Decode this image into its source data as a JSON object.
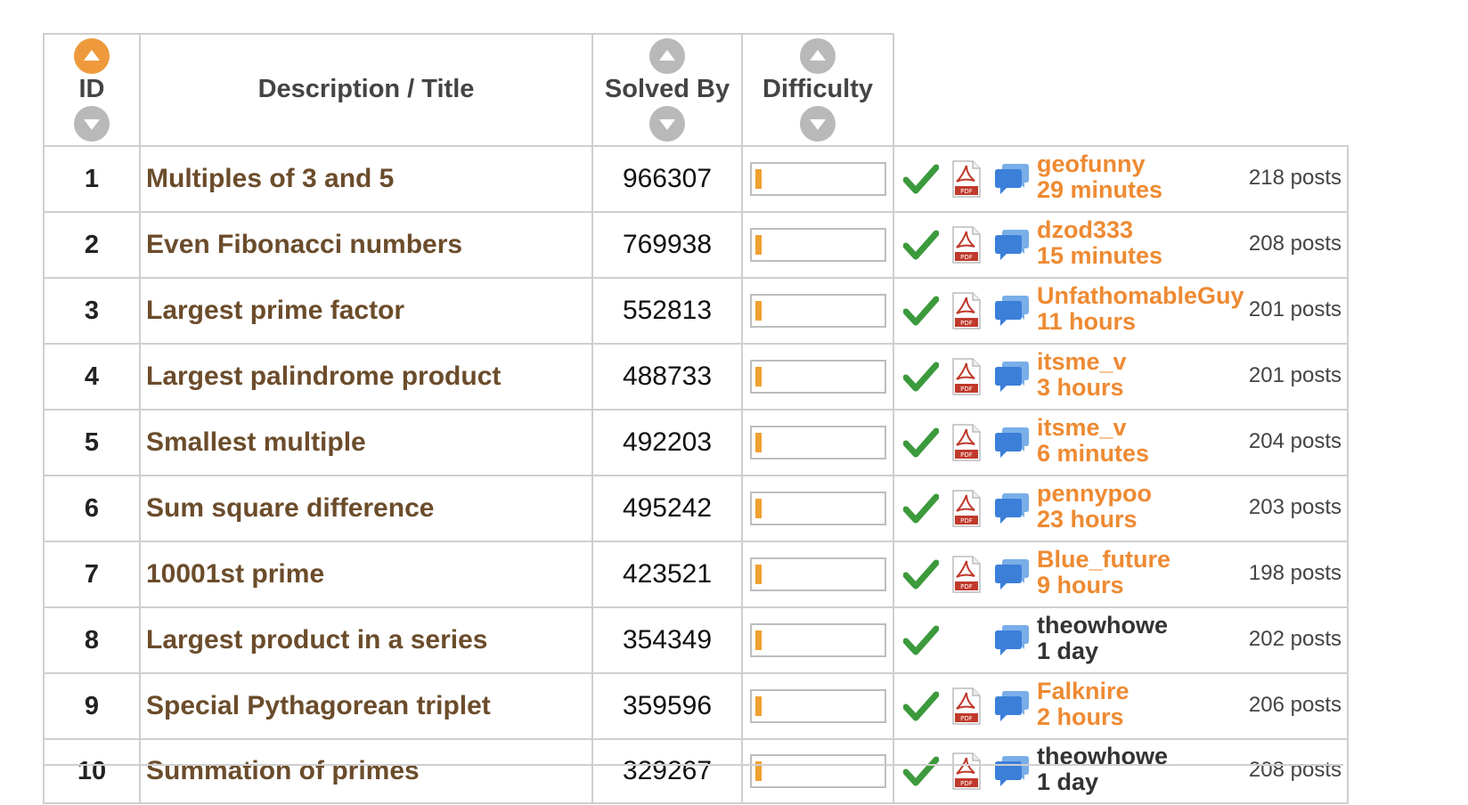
{
  "header": {
    "id_label": "ID",
    "title_label": "Description / Title",
    "solved_label": "Solved By",
    "difficulty_label": "Difficulty"
  },
  "colors": {
    "accent": "#ee9a3c",
    "title": "#6b4c2b",
    "author_orange": "#ee8a32",
    "check": "#3c9a3c",
    "chat": "#3b7fd9"
  },
  "problems": [
    {
      "id": "1",
      "title": "Multiples of 3 and 5",
      "solved_by": "966307",
      "difficulty_fraction": 0.05,
      "has_pdf": true,
      "last_by": "geofunny",
      "time": "29 minutes",
      "highlight": true,
      "posts": "218 posts"
    },
    {
      "id": "2",
      "title": "Even Fibonacci numbers",
      "solved_by": "769938",
      "difficulty_fraction": 0.05,
      "has_pdf": true,
      "last_by": "dzod333",
      "time": "15 minutes",
      "highlight": true,
      "posts": "208 posts"
    },
    {
      "id": "3",
      "title": "Largest prime factor",
      "solved_by": "552813",
      "difficulty_fraction": 0.05,
      "has_pdf": true,
      "last_by": "UnfathomableGuy",
      "time": "11 hours",
      "highlight": true,
      "posts": "201 posts"
    },
    {
      "id": "4",
      "title": "Largest palindrome product",
      "solved_by": "488733",
      "difficulty_fraction": 0.05,
      "has_pdf": true,
      "last_by": "itsme_v",
      "time": "3 hours",
      "highlight": true,
      "posts": "201 posts"
    },
    {
      "id": "5",
      "title": "Smallest multiple",
      "solved_by": "492203",
      "difficulty_fraction": 0.05,
      "has_pdf": true,
      "last_by": "itsme_v",
      "time": "6 minutes",
      "highlight": true,
      "posts": "204 posts"
    },
    {
      "id": "6",
      "title": "Sum square difference",
      "solved_by": "495242",
      "difficulty_fraction": 0.05,
      "has_pdf": true,
      "last_by": "pennypoo",
      "time": "23 hours",
      "highlight": true,
      "posts": "203 posts"
    },
    {
      "id": "7",
      "title": "10001st prime",
      "solved_by": "423521",
      "difficulty_fraction": 0.05,
      "has_pdf": true,
      "last_by": "Blue_future",
      "time": "9 hours",
      "highlight": true,
      "posts": "198 posts"
    },
    {
      "id": "8",
      "title": "Largest product in a series",
      "solved_by": "354349",
      "difficulty_fraction": 0.05,
      "has_pdf": false,
      "last_by": "theowhowe",
      "time": "1 day",
      "highlight": false,
      "posts": "202 posts"
    },
    {
      "id": "9",
      "title": "Special Pythagorean triplet",
      "solved_by": "359596",
      "difficulty_fraction": 0.05,
      "has_pdf": true,
      "last_by": "Falknire",
      "time": "2 hours",
      "highlight": true,
      "posts": "206 posts"
    },
    {
      "id": "10",
      "title": "Summation of primes",
      "solved_by": "329267",
      "difficulty_fraction": 0.05,
      "has_pdf": true,
      "last_by": "theowhowe",
      "time": "1 day",
      "highlight": false,
      "posts": "208 posts"
    }
  ],
  "icons": {
    "sort_up": "sort-up-icon",
    "sort_down": "sort-down-icon",
    "solved": "checkmark-icon",
    "pdf": "pdf-icon",
    "forum": "chat-bubble-icon"
  }
}
